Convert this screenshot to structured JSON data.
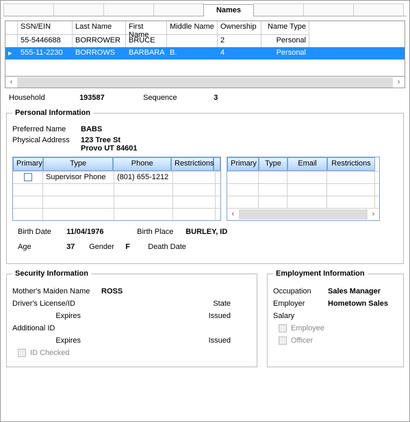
{
  "tabs": {
    "active": "Names"
  },
  "names_grid": {
    "columns": [
      "SSN/EIN",
      "Last Name",
      "First Name",
      "Middle Name",
      "Ownership",
      "Name Type"
    ],
    "rows": [
      {
        "ssn": "55-5446688",
        "last": "BORROWER",
        "first": "BRUCE",
        "middle": "",
        "own": "2",
        "type": "Personal",
        "selected": false
      },
      {
        "ssn": "555-11-2230",
        "last": "BORROWS",
        "first": "BARBARA",
        "middle": "B.",
        "own": "4",
        "type": "Personal",
        "selected": true
      }
    ]
  },
  "household": {
    "label": "Household",
    "value": "193587"
  },
  "sequence": {
    "label": "Sequence",
    "value": "3"
  },
  "personal": {
    "legend": "Personal Information",
    "preferred_label": "Preferred Name",
    "preferred_value": "BABS",
    "address_label": "Physical Address",
    "address_line1": "123 Tree St",
    "address_line2": "Provo UT 84601",
    "phone_columns": [
      "Primary",
      "Type",
      "Phone",
      "Restrictions"
    ],
    "phone_rows": [
      {
        "primary": false,
        "type": "Supervisor Phone",
        "phone": "(801) 655-1212",
        "restrictions": ""
      }
    ],
    "email_columns": [
      "Primary",
      "Type",
      "Email",
      "Restrictions"
    ],
    "birth_date_label": "Birth Date",
    "birth_date": "11/04/1976",
    "birth_place_label": "Birth Place",
    "birth_place": "BURLEY, ID",
    "age_label": "Age",
    "age": "37",
    "gender_label": "Gender",
    "gender": "F",
    "death_label": "Death Date",
    "death_date": ""
  },
  "security": {
    "legend": "Security Information",
    "maiden_label": "Mother's Maiden Name",
    "maiden_value": "ROSS",
    "dl_label": "Driver's License/ID",
    "state_label": "State",
    "expires_label": "Expires",
    "issued_label": "Issued",
    "addl_label": "Additional ID",
    "id_checked_label": "ID Checked"
  },
  "employment": {
    "legend": "Employment Information",
    "occupation_label": "Occupation",
    "occupation": "Sales Manager",
    "employer_label": "Employer",
    "employer": "Hometown Sales",
    "salary_label": "Salary",
    "salary": "",
    "employee_label": "Employee",
    "officer_label": "Officer"
  }
}
